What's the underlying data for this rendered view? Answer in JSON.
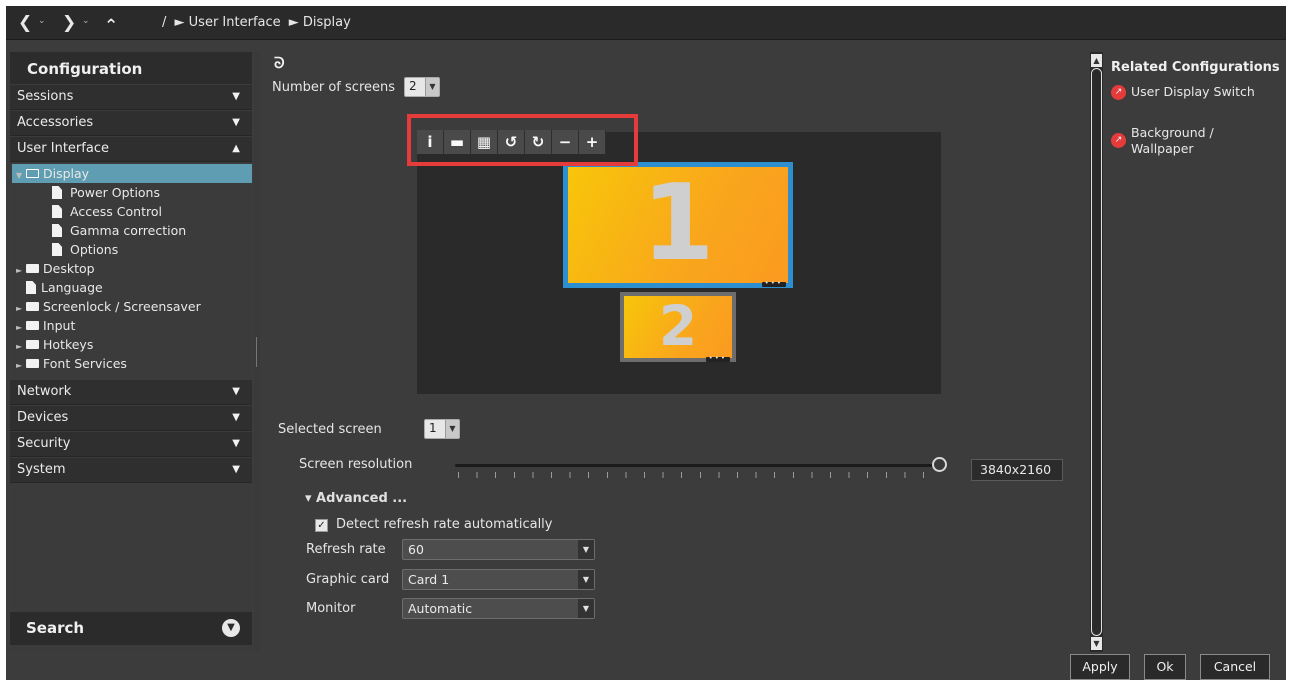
{
  "nav": {
    "back": "❮",
    "forward": "❯",
    "up": "⌃",
    "breadcrumb": [
      "/",
      "► User Interface",
      "► Display"
    ]
  },
  "sidebar": {
    "title": "Configuration",
    "categories_top": [
      {
        "label": "Sessions",
        "arrow": "▼"
      },
      {
        "label": "Accessories",
        "arrow": "▼"
      },
      {
        "label": "User Interface",
        "arrow": "▲"
      }
    ],
    "tree": [
      {
        "label": "Display",
        "icon": "folder-open",
        "toggle": "▼",
        "selected": true
      },
      {
        "label": "Power Options",
        "icon": "file"
      },
      {
        "label": "Access Control",
        "icon": "file"
      },
      {
        "label": "Gamma correction",
        "icon": "file"
      },
      {
        "label": "Options",
        "icon": "file"
      },
      {
        "label": "Desktop",
        "icon": "folder",
        "toggle": "►"
      },
      {
        "label": "Language",
        "icon": "file"
      },
      {
        "label": "Screenlock / Screensaver",
        "icon": "folder",
        "toggle": "►"
      },
      {
        "label": "Input",
        "icon": "folder",
        "toggle": "►"
      },
      {
        "label": "Hotkeys",
        "icon": "folder",
        "toggle": "►"
      },
      {
        "label": "Font Services",
        "icon": "folder",
        "toggle": "►"
      }
    ],
    "categories_bottom": [
      {
        "label": "Network",
        "arrow": "▼"
      },
      {
        "label": "Devices",
        "arrow": "▼"
      },
      {
        "label": "Security",
        "arrow": "▼"
      },
      {
        "label": "System",
        "arrow": "▼"
      }
    ],
    "search_label": "Search",
    "search_icon": "▼"
  },
  "main": {
    "reset_icon": "ᘐ",
    "num_screens_label": "Number of screens",
    "num_screens_value": "2",
    "toolbar": [
      {
        "name": "info-icon",
        "glyph": "i"
      },
      {
        "name": "layout-row-icon",
        "glyph": "▬"
      },
      {
        "name": "layout-grid-icon",
        "glyph": "▦"
      },
      {
        "name": "rotate-left-icon",
        "glyph": "↺"
      },
      {
        "name": "rotate-right-icon",
        "glyph": "↻"
      },
      {
        "name": "zoom-out-icon",
        "glyph": "−"
      },
      {
        "name": "zoom-in-icon",
        "glyph": "+"
      }
    ],
    "screen1_label": "1",
    "screen2_label": "2",
    "screen_dots": "•••",
    "selected_screen_label": "Selected screen",
    "selected_screen_value": "1",
    "resolution_label": "Screen resolution",
    "resolution_value": "3840x2160",
    "resolution_slider_fraction": 1.0,
    "advanced_label": "▾  Advanced ...",
    "detect_refresh_label": "Detect refresh rate automatically",
    "detect_refresh_checked": "✓",
    "refresh_rate_label": "Refresh rate",
    "refresh_rate_value": "60",
    "graphic_card_label": "Graphic card",
    "graphic_card_value": "Card 1",
    "monitor_label": "Monitor",
    "monitor_value": "Automatic"
  },
  "related": {
    "title": "Related Configurations",
    "items": [
      {
        "label": "User Display Switch"
      },
      {
        "label": "Background /\nWallpaper"
      }
    ]
  },
  "buttons": {
    "apply": "Apply",
    "ok": "Ok",
    "cancel": "Cancel"
  },
  "colors": {
    "highlight": "#e53b3b",
    "selected_row": "#5f9eb2",
    "screen_border_active": "#2e8fd0"
  }
}
